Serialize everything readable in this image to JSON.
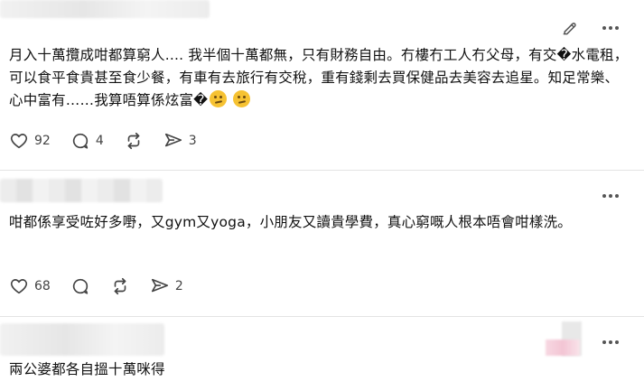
{
  "posts": [
    {
      "text": "月入十萬攬成咁都算窮人.... 我半個十萬都無，只有財務自由。冇樓冇工人冇父母，有交�水電租，可以食平食貴甚至食少餐，有車有去旅行有交稅，重有錢剩去買保健品去美容去追星。知足常樂、心中富有……我算唔算係炫富�",
      "emojis": [
        "thinking-face",
        "thinking-face"
      ],
      "likes": "92",
      "replies": "4",
      "reposts": "",
      "shares": "3"
    },
    {
      "text": "咁都係享受咗好多嘢，又gym又yoga，小朋友又讀貴學費，真心窮嘅人根本唔會咁樣洗。",
      "likes": "68",
      "replies": "",
      "reposts": "",
      "shares": "2"
    },
    {
      "text": "兩公婆都各自搵十萬咪得"
    }
  ],
  "colors": {
    "text": "#111111",
    "icon": "#444444",
    "divider": "#e3e3e3",
    "emoji": "#f6c232"
  }
}
